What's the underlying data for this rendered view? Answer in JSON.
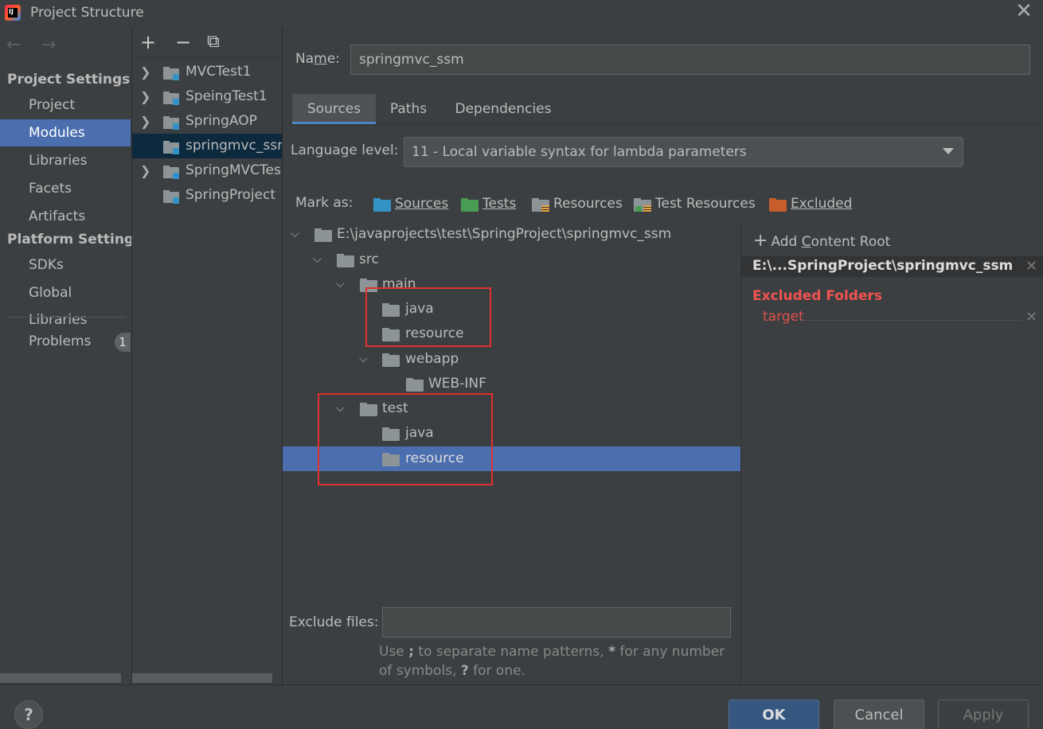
{
  "window": {
    "title": "Project Structure",
    "app_icon": "intellij-icon",
    "close_icon": "✕"
  },
  "nav": {
    "back": "←",
    "forward": "→"
  },
  "sidebar": {
    "project_settings_heading": "Project Settings",
    "project_settings_items": [
      {
        "label": "Project"
      },
      {
        "label": "Modules",
        "selected": true
      },
      {
        "label": "Libraries"
      },
      {
        "label": "Facets"
      },
      {
        "label": "Artifacts"
      }
    ],
    "platform_settings_heading": "Platform Settings",
    "platform_settings_items": [
      {
        "label": "SDKs"
      },
      {
        "label": "Global Libraries"
      }
    ],
    "problems": {
      "label": "Problems",
      "count": "1"
    }
  },
  "module_toolbar": {
    "add": "+",
    "remove": "−",
    "copy": "⧉"
  },
  "modules": [
    {
      "label": "MVCTest1",
      "expandable": true
    },
    {
      "label": "SpeingTest1",
      "expandable": true
    },
    {
      "label": "SpringAOP",
      "expandable": true
    },
    {
      "label": "springmvc_ssm",
      "expandable": false,
      "selected": true
    },
    {
      "label": "SpringMVCTes",
      "expandable": true
    },
    {
      "label": "SpringProject",
      "expandable": false
    }
  ],
  "module_detail": {
    "name_label_pre": "Na",
    "name_label_mn": "m",
    "name_label_post": "e:",
    "name_value": "springmvc_ssm",
    "tabs": [
      {
        "label": "Sources",
        "active": true
      },
      {
        "label": "Paths"
      },
      {
        "label": "Dependencies"
      }
    ],
    "language_level_label": "Language level:",
    "language_level_value": "11 - Local variable syntax for lambda parameters",
    "mark_as_label": "Mark as:",
    "mark_as": [
      {
        "label": "Sources",
        "color": "#3592c4"
      },
      {
        "label": "Tests",
        "color": "#499c54"
      },
      {
        "label": "Resources",
        "color": "#8c9498"
      },
      {
        "label": "Test Resources",
        "color": "#8c9498"
      },
      {
        "label": "Excluded",
        "color": "#c75d2c"
      }
    ]
  },
  "tree": [
    {
      "label": "E:\\javaprojects\\test\\SpringProject\\springmvc_ssm",
      "depth": 0,
      "expanded": true
    },
    {
      "label": "src",
      "depth": 1,
      "expanded": true
    },
    {
      "label": "main",
      "depth": 2,
      "expanded": true
    },
    {
      "label": "java",
      "depth": 3
    },
    {
      "label": "resource",
      "depth": 3
    },
    {
      "label": "webapp",
      "depth": 3,
      "expanded": true
    },
    {
      "label": "WEB-INF",
      "depth": 4
    },
    {
      "label": "test",
      "depth": 2,
      "expanded": true
    },
    {
      "label": "java",
      "depth": 3
    },
    {
      "label": "resource",
      "depth": 3,
      "selected": true
    }
  ],
  "exclude_files": {
    "label": "Exclude files:",
    "value": "",
    "hint_1": "Use ",
    "hint_semicolon": ";",
    "hint_2": " to separate name patterns, ",
    "hint_star": "*",
    "hint_3": " for any number of symbols, ",
    "hint_q": "?",
    "hint_4": " for one."
  },
  "content_root": {
    "add_label_pre": "Add ",
    "add_label_c": "C",
    "add_label_post": "ontent Root",
    "root_path": "E:\\...SpringProject\\springmvc_ssm",
    "excluded_heading": "Excluded Folders",
    "excluded_items": [
      "target"
    ]
  },
  "buttons": {
    "help": "?",
    "ok": "OK",
    "cancel": "Cancel",
    "apply": "Apply"
  },
  "colors": {
    "selection": "#4b6eaf",
    "accent_tab": "#4a88c7",
    "annotation": "#e0302e",
    "excluded": "#ef5350"
  }
}
